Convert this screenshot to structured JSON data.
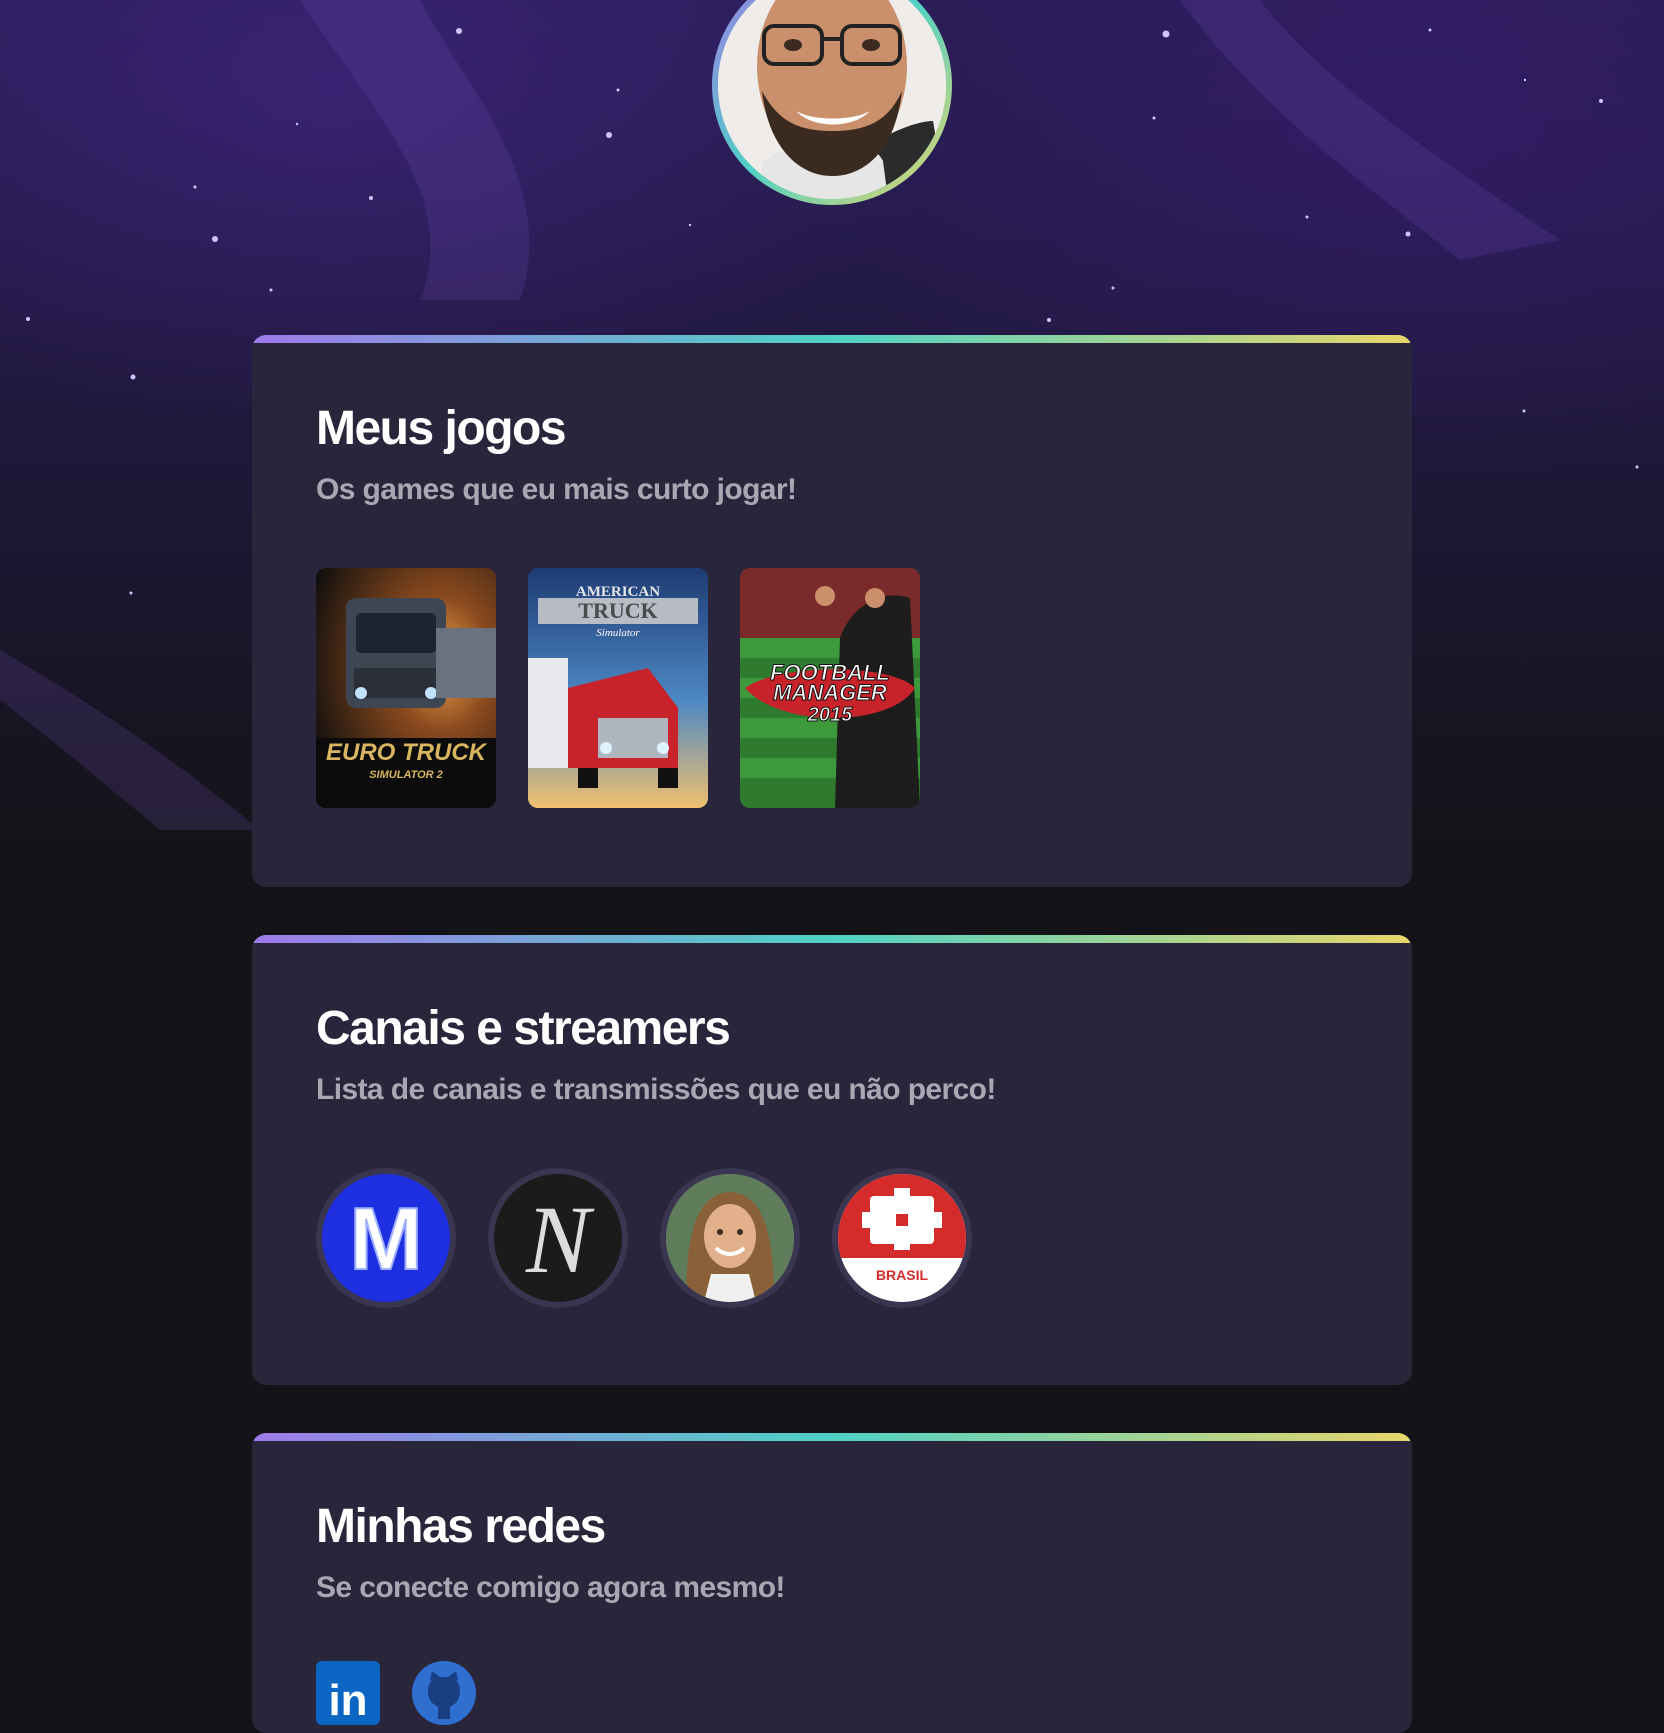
{
  "profile": {
    "avatar": "profile-photo-smiling-man-glasses"
  },
  "games_section": {
    "title": "Meus jogos",
    "subtitle": "Os games que eu mais curto jogar!",
    "games": [
      {
        "name": "Euro Truck Simulator 2",
        "logo_line1": "EURO TRUCK",
        "logo_line2": "SIMULATOR 2"
      },
      {
        "name": "American Truck Simulator",
        "logo_line1": "AMERICAN",
        "logo_line2": "TRUCK",
        "logo_line3": "Simulator"
      },
      {
        "name": "Football Manager 2015",
        "logo_line1": "FOOTBALL",
        "logo_line2": "MANAGER",
        "logo_line3": "2015"
      }
    ]
  },
  "channels_section": {
    "title": "Canais e streamers",
    "subtitle": "Lista de canais e transmissões que eu não perco!",
    "channels": [
      {
        "avatar_letter": "M",
        "bg": "#1d2fe0"
      },
      {
        "avatar_letter": "N",
        "bg": "#1b1b1b"
      },
      {
        "avatar_letter": "",
        "bg": "#6b8a6a",
        "icon": "streamer-photo"
      },
      {
        "avatar_letter": "",
        "bg": "#ffffff",
        "badge_text": "BRASIL",
        "icon": "ign-logo"
      }
    ]
  },
  "networks_section": {
    "title": "Minhas redes",
    "subtitle": "Se conecte comigo agora mesmo!",
    "networks": [
      {
        "icon": "linkedin-icon",
        "label": "in"
      },
      {
        "icon": "github-icon"
      }
    ]
  },
  "colors": {
    "accent_gradient": [
      "#9f7aea",
      "#4fd1c5",
      "#e8d56a"
    ],
    "card_bg": "#29253a",
    "page_bg": "#141317"
  }
}
